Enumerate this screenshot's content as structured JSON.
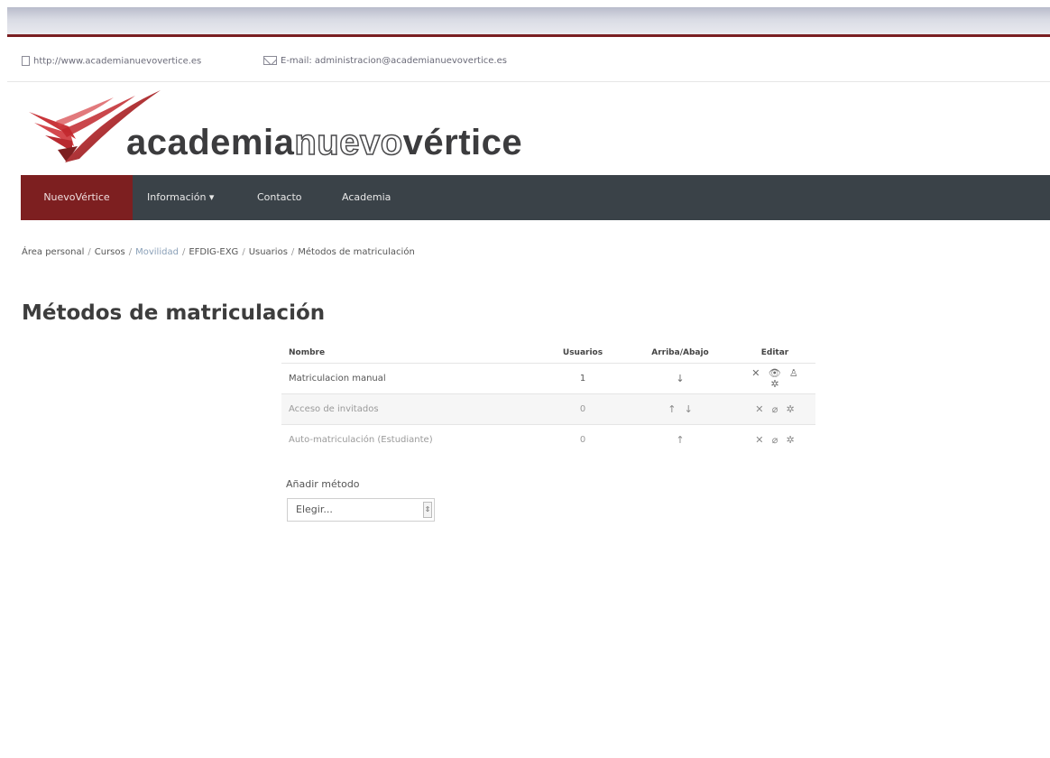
{
  "contact": {
    "website": "http://www.academianuevovertice.es",
    "email": "E-mail: administracion@academianuevovertice.es"
  },
  "logo": {
    "part1": "academia",
    "part2": "nuevo",
    "part3": "vértice",
    "colors": {
      "red": "#c1272d",
      "dark_red": "#7d1f20",
      "text": "#3c3c3e"
    }
  },
  "nav": {
    "items": [
      {
        "label": "NuevoVértice"
      },
      {
        "label": "Información ▾"
      },
      {
        "label": "Contacto"
      },
      {
        "label": "Academia"
      }
    ]
  },
  "breadcrumb": {
    "items": [
      "Área personal",
      "Cursos",
      "Movilidad",
      "EFDIG-EXG",
      "Usuarios",
      "Métodos de matriculación"
    ]
  },
  "page": {
    "title": "Métodos de matriculación"
  },
  "table": {
    "headers": {
      "name": "Nombre",
      "users": "Usuarios",
      "updown": "Arriba/Abajo",
      "edit": "Editar"
    },
    "rows": [
      {
        "name": "Matriculacion manual",
        "users": "1",
        "updown": [
          "arrow-down-icon"
        ],
        "edit": [
          "delete-icon",
          "disable-icon",
          "enrol-users-icon",
          "settings-icon"
        ]
      },
      {
        "name": "Acceso de invitados",
        "users": "0",
        "updown": [
          "arrow-up-icon",
          "arrow-down-icon"
        ],
        "edit": [
          "delete-icon",
          "enable-icon",
          "settings-icon"
        ]
      },
      {
        "name": "Auto-matriculación (Estudiante)",
        "users": "0",
        "updown": [
          "arrow-up-icon"
        ],
        "edit": [
          "delete-icon",
          "enable-icon",
          "settings-icon"
        ]
      }
    ]
  },
  "add_method": {
    "label": "Añadir método",
    "select_value": "Elegir..."
  }
}
